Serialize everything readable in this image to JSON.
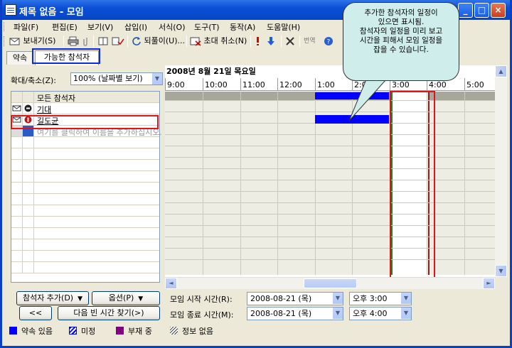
{
  "window": {
    "title": "제목 없음 - 모임",
    "min": "_",
    "max": "□",
    "close": "×"
  },
  "menu": [
    "파일(F)",
    "편집(E)",
    "보기(V)",
    "삽입(I)",
    "서식(O)",
    "도구(T)",
    "동작(A)",
    "도움말(H)"
  ],
  "toolbar": {
    "send": "보내기(S)",
    "recurrence": "되풀이(U)...",
    "cancel_invite": "초대 취소(N)",
    "translate": "번역"
  },
  "tabs": {
    "appointment": "약속",
    "scheduling": "가능한 참석자"
  },
  "zoom": {
    "label": "확대/축소(Z):",
    "value": "100% (날짜별 보기)"
  },
  "attendees": {
    "header": "모든 참석자",
    "rows": [
      {
        "name": "기대",
        "role": "organizer"
      },
      {
        "name": "길도균",
        "role": "required"
      }
    ],
    "add_placeholder": "여기를 클릭하여 이름을 추가하십시오."
  },
  "schedule": {
    "date": "2008년 8월 21일 목요일",
    "times": [
      "9:00",
      "10:00",
      "11:00",
      "12:00",
      "1:00",
      "2:00",
      "3:00",
      "4:00",
      "5:00"
    ]
  },
  "buttons": {
    "add_attendees": "참석자 추가(D)",
    "options": "옵션(P)",
    "prev": "<<",
    "next_free": "다음 빈 시간 찾기(>)"
  },
  "meeting": {
    "start_label": "모임 시작 시간(R):",
    "start_date": "2008-08-21 (목)",
    "start_time": "오후 3:00",
    "end_label": "모임 종료 시간(M):",
    "end_date": "2008-08-21 (목)",
    "end_time": "오후 4:00"
  },
  "legend": [
    "약속 있음",
    "미정",
    "부재 중",
    "정보 없음"
  ],
  "colors": {
    "busy": "#0000FF",
    "tentative": "#0000FF",
    "out_of_office": "#800080",
    "no_info": "#FFFFFF",
    "highlight_red": "#E0141A",
    "callout_bg": "#CFEDEB"
  },
  "callout": {
    "lines": [
      "추가한 참석자의 일정이",
      "있으면 표시됨.",
      "참석자의 일정을 미리 보고",
      "시간을 피해서 모임 일정을",
      "잡을 수 있습니다."
    ]
  }
}
